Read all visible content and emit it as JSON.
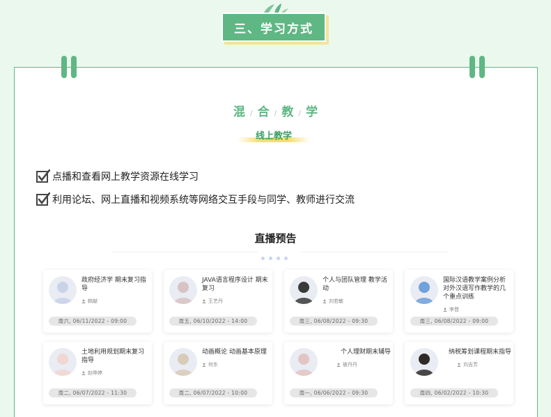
{
  "section": {
    "title": "三、学习方式"
  },
  "hybrid": {
    "chars": [
      "混",
      "合",
      "教",
      "学"
    ],
    "separator": "/"
  },
  "online": {
    "subtitle": "线上教学"
  },
  "features": [
    {
      "text": "点播和查看网上教学资源在线学习"
    },
    {
      "text": "利用论坛、网上直播和视频系统等网络交互手段与同学、教师进行交流"
    }
  ],
  "live": {
    "title": "直播预告",
    "cards": [
      {
        "course": "政府经济学 期末复习指导",
        "teacher": "韩献",
        "time": "周六, 06/11/2022 - 09:00",
        "avatar_color": "#c9d3e8"
      },
      {
        "course": "JAVA语言程序设计 期末复习",
        "teacher": "王艺丹",
        "time": "周五, 06/10/2022 - 14:00",
        "avatar_color": "#d7c3c3"
      },
      {
        "course": "个人与团队管理 教学活动",
        "teacher": "刘若敏",
        "time": "周三, 06/08/2022 - 09:30",
        "avatar_color": "#3a3a3a"
      },
      {
        "course": "国际汉语教学案例分析 对外汉语写作教学的几个重点训练",
        "teacher": "李晋",
        "time": "周三, 06/08/2022 - 09:00",
        "avatar_color": "#6fa1dc"
      },
      {
        "course": "土地利用规划期末复习指导",
        "teacher": "赵晔婷",
        "time": "周二, 06/07/2022 - 11:30",
        "avatar_color": "#f0d7d3"
      },
      {
        "course": "动画概论 动画基本原理",
        "teacher": "何东",
        "time": "周二, 06/07/2022 - 10:00",
        "avatar_color": "#d9cbb9"
      },
      {
        "course": "个人理财期末辅导",
        "teacher": "彼丹丹",
        "time": "周一, 06/06/2022 - 09:30",
        "avatar_color": "#e3c4c4"
      },
      {
        "course": "纳税筹划课程期末指导",
        "teacher": "刘吉芳",
        "time": "周四, 06/02/2022 - 10:30",
        "avatar_color": "#2e2a28"
      }
    ]
  },
  "colors": {
    "accent": "#5fb784",
    "page_bg": "#eaf8ee",
    "highlight": "#f6de72"
  }
}
